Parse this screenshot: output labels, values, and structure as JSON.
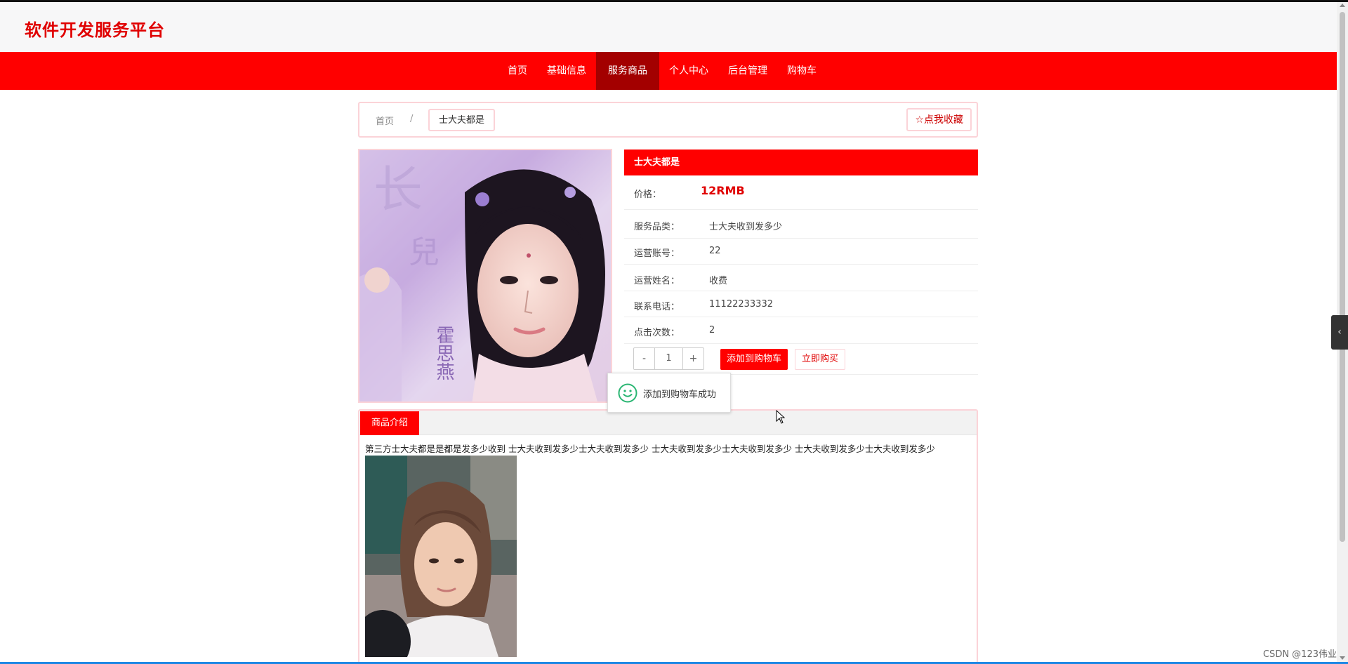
{
  "site": {
    "title": "软件开发服务平台"
  },
  "nav": {
    "items": [
      {
        "label": "首页",
        "active": false
      },
      {
        "label": "基础信息",
        "active": false
      },
      {
        "label": "服务商品",
        "active": true
      },
      {
        "label": "个人中心",
        "active": false
      },
      {
        "label": "后台管理",
        "active": false
      },
      {
        "label": "购物车",
        "active": false
      }
    ]
  },
  "breadcrumb": {
    "home": "首页",
    "separator": "/",
    "current": "士大夫都是"
  },
  "favorite": {
    "label": "点我收藏",
    "icon": "star-outline-icon"
  },
  "product": {
    "name": "士大夫都是",
    "price_label": "价格：",
    "price": "12RMB",
    "details": [
      {
        "label": "服务品类：",
        "value": "士大夫收到发多少"
      },
      {
        "label": "运营账号：",
        "value": "22"
      },
      {
        "label": "运营姓名：",
        "value": "收费"
      },
      {
        "label": "联系电话：",
        "value": "11122233332"
      },
      {
        "label": "点击次数：",
        "value": "2"
      }
    ]
  },
  "quantity": {
    "minus": "-",
    "value": "1",
    "plus": "+"
  },
  "actions": {
    "add_to_cart": "添加到购物车",
    "buy_now": "立即购买"
  },
  "toast": {
    "message": "添加到购物车成功",
    "icon": "smile-face-icon"
  },
  "description": {
    "tab": "商品介绍",
    "text": "第三方士大夫都是是都是发多少收到 士大夫收到发多少士大夫收到发多少 士大夫收到发多少士大夫收到发多少 士大夫收到发多少士大夫收到发多少"
  },
  "watermark": "CSDN @123伟业",
  "colors": {
    "brand": "#ff0000",
    "nav_active": "#a30000",
    "border": "#fbd3d8"
  }
}
